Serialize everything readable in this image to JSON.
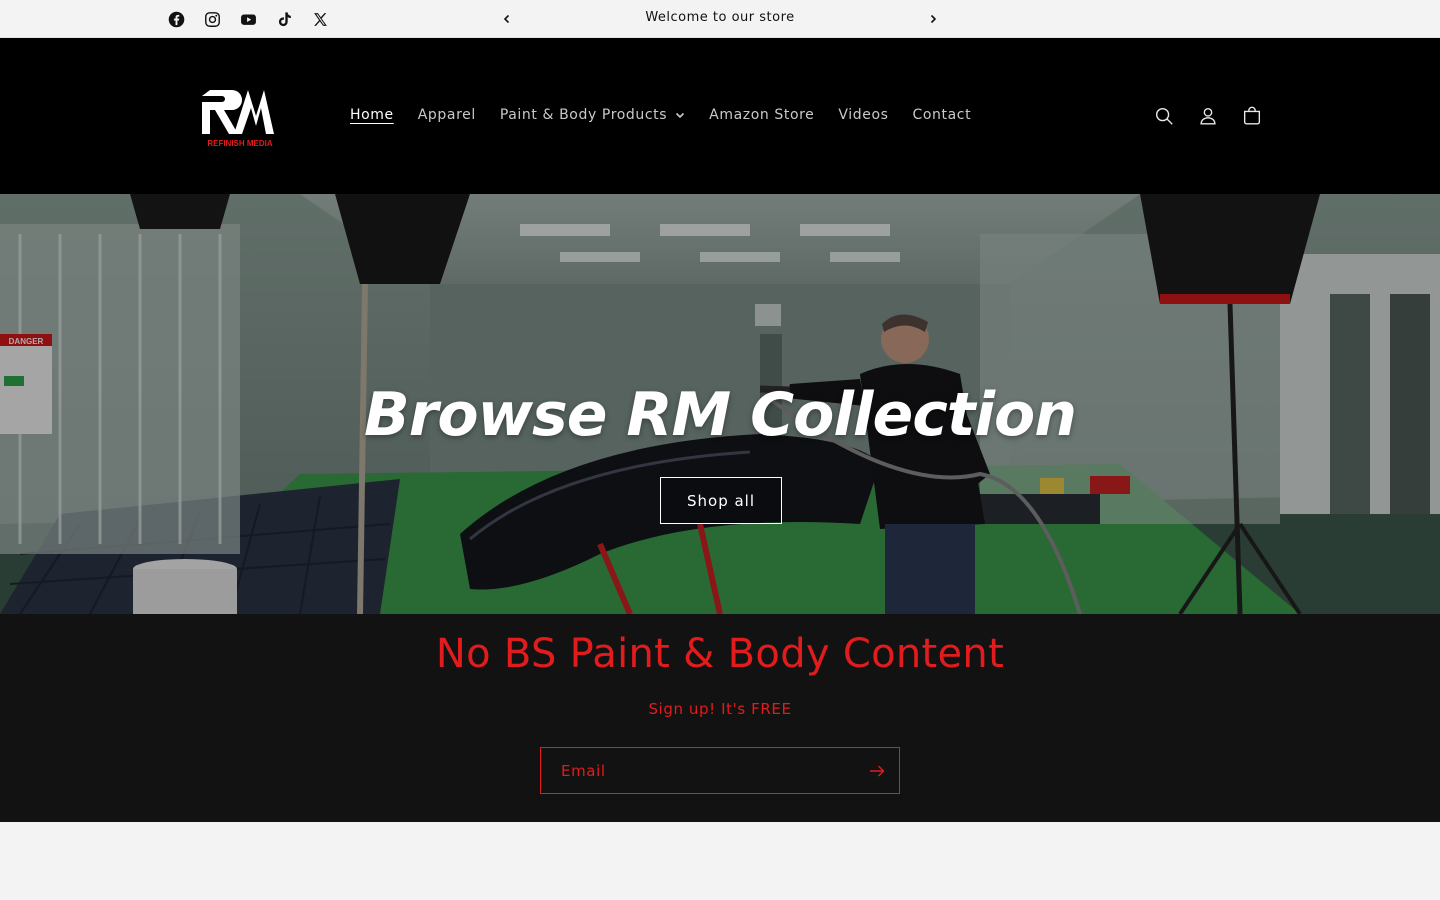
{
  "announcement": {
    "text": "Welcome to our store",
    "social": [
      {
        "name": "facebook-icon"
      },
      {
        "name": "instagram-icon"
      },
      {
        "name": "youtube-icon"
      },
      {
        "name": "tiktok-icon"
      },
      {
        "name": "x-twitter-icon"
      }
    ]
  },
  "header": {
    "logo": {
      "letters": "RM",
      "tagline": "REFINISH MEDIA"
    },
    "nav": [
      {
        "label": "Home",
        "active": true
      },
      {
        "label": "Apparel"
      },
      {
        "label": "Paint & Body Products",
        "dropdown": true
      },
      {
        "label": "Amazon Store"
      },
      {
        "label": "Videos"
      },
      {
        "label": "Contact"
      }
    ],
    "icons": [
      "search-icon",
      "account-icon",
      "cart-icon"
    ]
  },
  "hero": {
    "title": "Browse RM Collection",
    "button": "Shop all",
    "sign_text": "DANGER"
  },
  "newsletter": {
    "title": "No BS Paint & Body Content",
    "subtitle": "Sign up! It's FREE",
    "email_placeholder": "Email"
  },
  "colors": {
    "accent_red": "#e21c1c",
    "header_bg": "#000000",
    "newsletter_bg": "#121212",
    "page_bg": "#f3f3f3"
  }
}
